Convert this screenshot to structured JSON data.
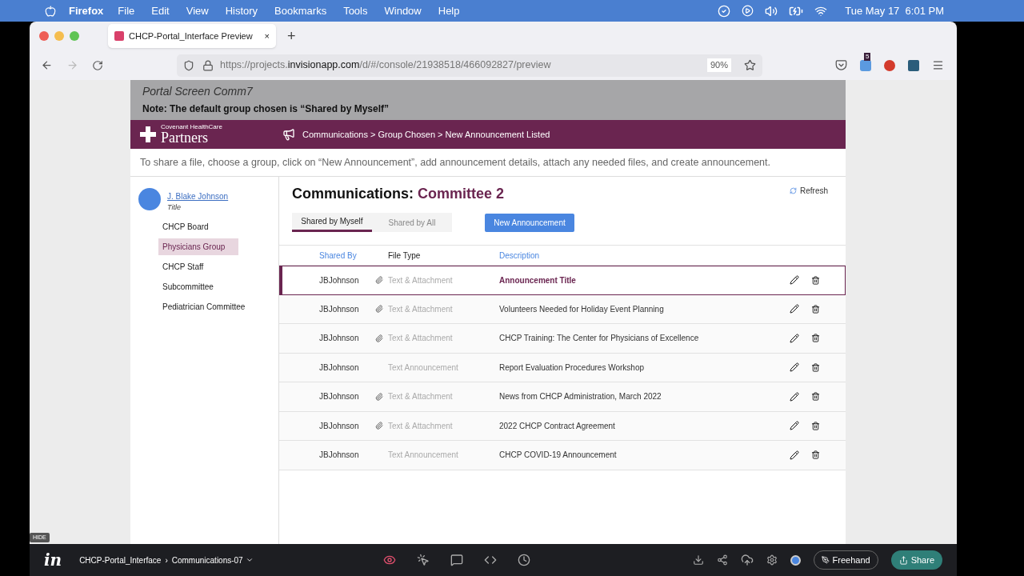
{
  "menubar": {
    "app": "Firefox",
    "menus": [
      "File",
      "Edit",
      "View",
      "History",
      "Bookmarks",
      "Tools",
      "Window",
      "Help"
    ],
    "clock": "Tue May 17  6:01 PM"
  },
  "browser": {
    "tab": {
      "title": "CHCP-Portal_Interface Preview",
      "close": "×"
    },
    "new_tab": "+",
    "url_prefix": "https://projects.",
    "url_domain": "invisionapp.com",
    "url_path": "/d/#/console/21938518/466092827/preview",
    "zoom": "90%",
    "badge": "5"
  },
  "annotation": {
    "title": "Portal Screen Comm7",
    "note": "Note: The default group chosen is “Shared by Myself”"
  },
  "header": {
    "logo_small": "Covenant HealthCare",
    "logo_big": "Partners",
    "breadcrumb": "Communications > Group Chosen > New Announcement Listed"
  },
  "instructions": "To share a file, choose a group, click on “New Announcement”, add announcement details, attach any needed files, and create announcement.",
  "user": {
    "name": "J. Blake Johnson",
    "title": "Title"
  },
  "groups": [
    {
      "label": "CHCP Board",
      "selected": false
    },
    {
      "label": "Physicians Group",
      "selected": true
    },
    {
      "label": "CHCP Staff",
      "selected": false
    },
    {
      "label": "Subcommittee",
      "selected": false
    },
    {
      "label": "Pediatrician Committee",
      "selected": false
    }
  ],
  "page_title": {
    "prefix": "Communications:",
    "group": "Committee 2"
  },
  "refresh": "Refresh",
  "tabs": [
    {
      "label": "Shared by Myself",
      "selected": true
    },
    {
      "label": "Shared by All",
      "selected": false
    }
  ],
  "new_button": "New Announcement",
  "table": {
    "columns": [
      "Shared By",
      "File Type",
      "Description"
    ],
    "rows": [
      {
        "shared_by": "JBJohnson",
        "attachment": true,
        "file_type": "Text & Attachment",
        "description": "Announcement Title",
        "selected": true
      },
      {
        "shared_by": "JBJohnson",
        "attachment": true,
        "file_type": "Text & Attachment",
        "description": "Volunteers Needed for Holiday Event Planning",
        "selected": false
      },
      {
        "shared_by": "JBJohnson",
        "attachment": true,
        "file_type": "Text & Attachment",
        "description": "CHCP Training: The Center for Physicians of Excellence",
        "selected": false
      },
      {
        "shared_by": "JBJohnson",
        "attachment": false,
        "file_type": "Text Announcement",
        "description": "Report Evaluation Procedures Workshop",
        "selected": false
      },
      {
        "shared_by": "JBJohnson",
        "attachment": true,
        "file_type": "Text & Attachment",
        "description": "News from CHCP Administration, March 2022",
        "selected": false
      },
      {
        "shared_by": "JBJohnson",
        "attachment": true,
        "file_type": "Text & Attachment",
        "description": "2022 CHCP Contract Agreement",
        "selected": false
      },
      {
        "shared_by": "JBJohnson",
        "attachment": false,
        "file_type": "Text Announcement",
        "description": "CHCP COVID-19 Announcement",
        "selected": false
      }
    ]
  },
  "hide": "HIDE",
  "bottom": {
    "logo": "in",
    "project": "CHCP-Portal_Interface",
    "separator": "›",
    "screen": "Communications-07",
    "freehand": "Freehand",
    "share": "Share"
  }
}
